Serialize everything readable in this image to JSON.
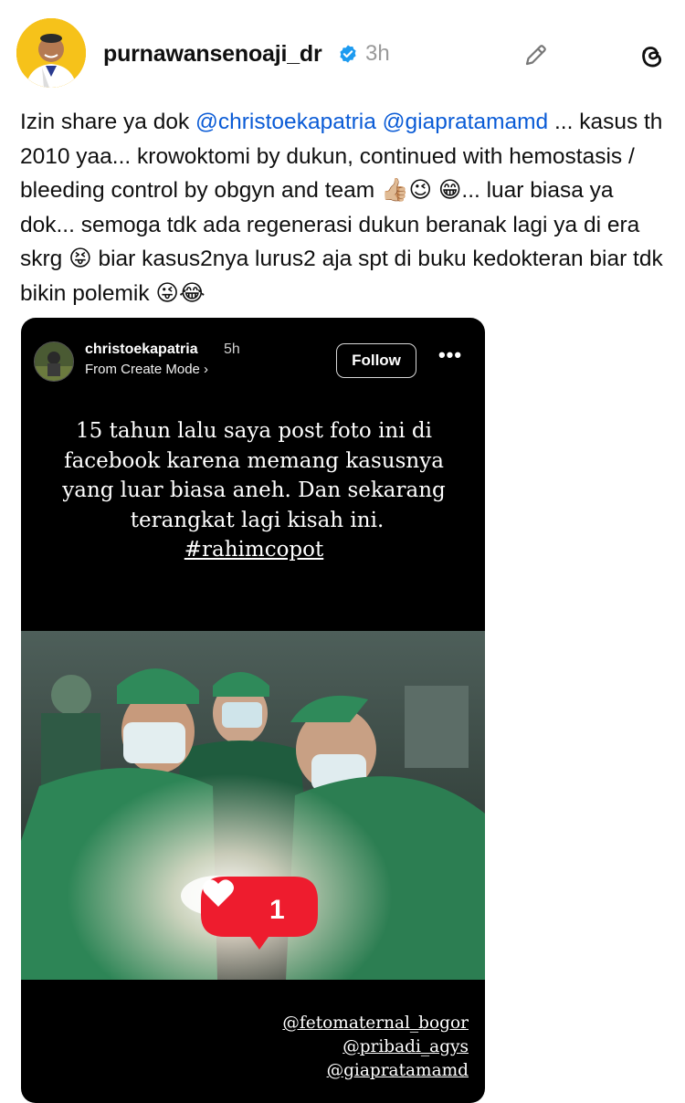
{
  "post": {
    "username": "purnawansenoaji_dr",
    "time": "3h",
    "icons": {
      "verified": "verified-badge-icon",
      "edit": "pencil-icon",
      "app": "threads-icon"
    },
    "caption": [
      {
        "text": "Izin share ya dok "
      },
      {
        "text": "@christoekapatria",
        "mention": true
      },
      {
        "text": " "
      },
      {
        "text": "@giapratamamd",
        "mention": true
      },
      {
        "text": " ... kasus th 2010 yaa... krowoktomi by dukun, continued with hemostasis / bleeding control by obgyn and team 👍🏼😉 😁... luar biasa ya dok... semoga tdk ada regenerasi dukun beranak lagi ya di era skrg 😝 biar kasus2nya lurus2 aja spt di buku kedokteran biar tdk bikin polemik 😜😂"
      }
    ]
  },
  "story": {
    "username": "christoekapatria",
    "time": "5h",
    "subtitle": "From Create Mode ›",
    "follow_label": "Follow",
    "more_label": "•••",
    "text_main": "15 tahun lalu saya post foto ini di facebook karena memang kasusnya yang luar biasa aneh. Dan sekarang terangkat lagi kisah ini.",
    "hashtag": "#rahimcopot",
    "like_count": "1",
    "tags": [
      "@fetomaternal_bogor",
      "@pribadi_agys",
      "@giapratamamd"
    ]
  },
  "colors": {
    "mention": "#0a5bd6",
    "verified": "#1d9bf0",
    "like_badge": "#ee1c2e",
    "story_bg": "#000000",
    "scrubs": "#2f8a5a"
  }
}
